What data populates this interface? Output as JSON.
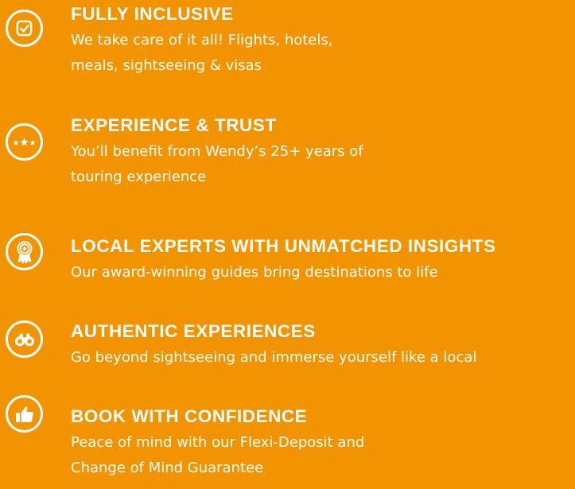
{
  "colors": {
    "background": "#F29301",
    "foreground": "#FFFFFF"
  },
  "features": [
    {
      "icon": "checkbox-icon",
      "title": "FULLY INCLUSIVE",
      "text_lines": [
        "We take care of it all! Flights, hotels,",
        "meals, sightseeing & visas"
      ]
    },
    {
      "icon": "stars-icon",
      "title": "EXPERIENCE & TRUST",
      "text_lines": [
        "You’ll benefit from Wendy’s 25+ years of",
        "touring experience"
      ]
    },
    {
      "icon": "award-ribbon-icon",
      "title": "LOCAL EXPERTS WITH UNMATCHED INSIGHTS",
      "text_lines": [
        "Our award-winning guides bring destinations to life"
      ]
    },
    {
      "icon": "binoculars-icon",
      "title": "AUTHENTIC EXPERIENCES",
      "text_lines": [
        "Go beyond sightseeing and immerse yourself like a local"
      ]
    },
    {
      "icon": "thumbs-up-icon",
      "title": "BOOK WITH CONFIDENCE",
      "text_lines": [
        "Peace of mind with our Flexi-Deposit and",
        "Change of Mind Guarantee"
      ]
    }
  ]
}
